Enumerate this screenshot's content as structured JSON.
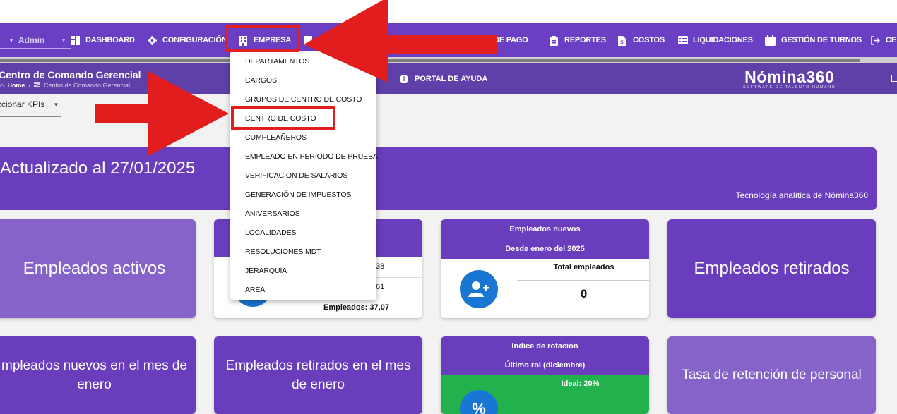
{
  "navbar": {
    "user": "Admin",
    "items": [
      {
        "label": "DASHBOARD",
        "icon": "dashboard-icon"
      },
      {
        "label": "CONFIGURACIÓN",
        "icon": "gear-icon"
      },
      {
        "label": "EMPRESA",
        "icon": "building-icon"
      },
      {
        "label": "DE PAGO",
        "icon": "document-icon"
      },
      {
        "label": "REPORTES",
        "icon": "clipboard-icon"
      },
      {
        "label": "COSTOS",
        "icon": "invoice-icon"
      },
      {
        "label": "LIQUIDACIONES",
        "icon": "list-icon"
      },
      {
        "label": "GESTIÓN DE TURNOS",
        "icon": "calendar-icon"
      },
      {
        "label": "CE",
        "icon": "logout-icon"
      }
    ]
  },
  "subbar": {
    "title": "Centro de Comando Gerencial",
    "breadcrumb_home": "Home",
    "breadcrumb_current": "Centro de Comando Gerencial",
    "portal": "PORTAL DE AYUDA",
    "brand_name": "Nómina360",
    "brand_tagline": "SOFTWARE DE TALENTO HUMANO"
  },
  "kpi_select": {
    "value": "ccionar KPIs"
  },
  "banner": {
    "updated": "Actualizado al 27/01/2025",
    "tech": "Tecnología analítica de Nómina360"
  },
  "cards": {
    "activos": "Empleados activos",
    "partial_line1": "38",
    "partial_line2": "61",
    "partial_line3": "Empleados: 37,07",
    "nuevos_head1": "Empleados nuevos",
    "nuevos_head2": "Desde enero del 2025",
    "nuevos_total_label": "Total empleados",
    "nuevos_total_value": "0",
    "retirados": "Empleados retirados",
    "nuevos_mes": "mpleados nuevos en el mes de enero",
    "retirados_mes": "Empleados retirados en el mes de enero",
    "rotacion_head1": "Indice de rotación",
    "rotacion_head2": "Último rol (diciembre)",
    "rotacion_ideal": "Ideal: 20%",
    "retencion": "Tasa de retención de personal"
  },
  "dropdown": {
    "items": [
      "DEPARTAMENTOS",
      "CARGOS",
      "GRUPOS DE CENTRO DE COSTO",
      "CENTRO DE COSTO",
      "CUMPLEAÑEROS",
      "EMPLEADO EN PERIODO DE PRUEBA",
      "VERIFICACION DE SALARIOS",
      "GENERACIÓN DE IMPUESTOS",
      "ANIVERSARIOS",
      "LOCALIDADES",
      "RESOLUCIONES MDT",
      "JERARQUÍA",
      "AREA"
    ]
  },
  "colors": {
    "nav": "#6b3fc4",
    "card_purple": "#6a3dbd",
    "annotation_red": "#e21d1d",
    "icon_blue": "#1976d2",
    "green": "#23b14d"
  }
}
